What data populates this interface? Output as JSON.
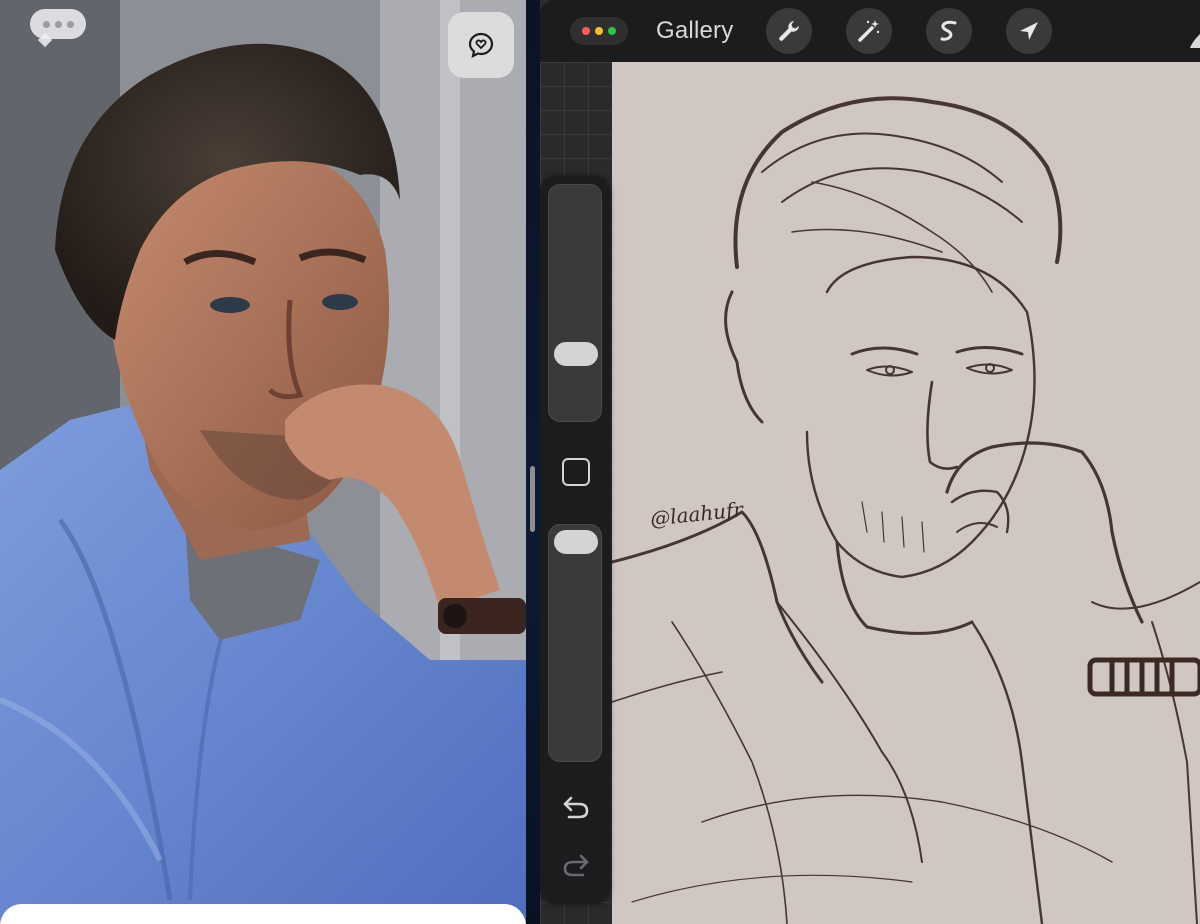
{
  "left_pane": {
    "more_icon": "ellipsis-bubble-icon",
    "react_icon": "heart-bubble-icon"
  },
  "procreate": {
    "window_dot_colors": [
      "#ff5f57",
      "#febc2e",
      "#28c840"
    ],
    "gallery_label": "Gallery",
    "tools": [
      "wrench-icon",
      "magic-wand-icon",
      "selection-s-icon",
      "arrow-cursor-icon"
    ],
    "canvas_color": "#d0c6c2",
    "ink_color": "#3b2a24",
    "signature": "@laahufr",
    "sidebar": {
      "brush_size": 0.25,
      "opacity": 1.0,
      "undo_icon": "undo-icon",
      "redo_icon": "redo-icon"
    }
  }
}
